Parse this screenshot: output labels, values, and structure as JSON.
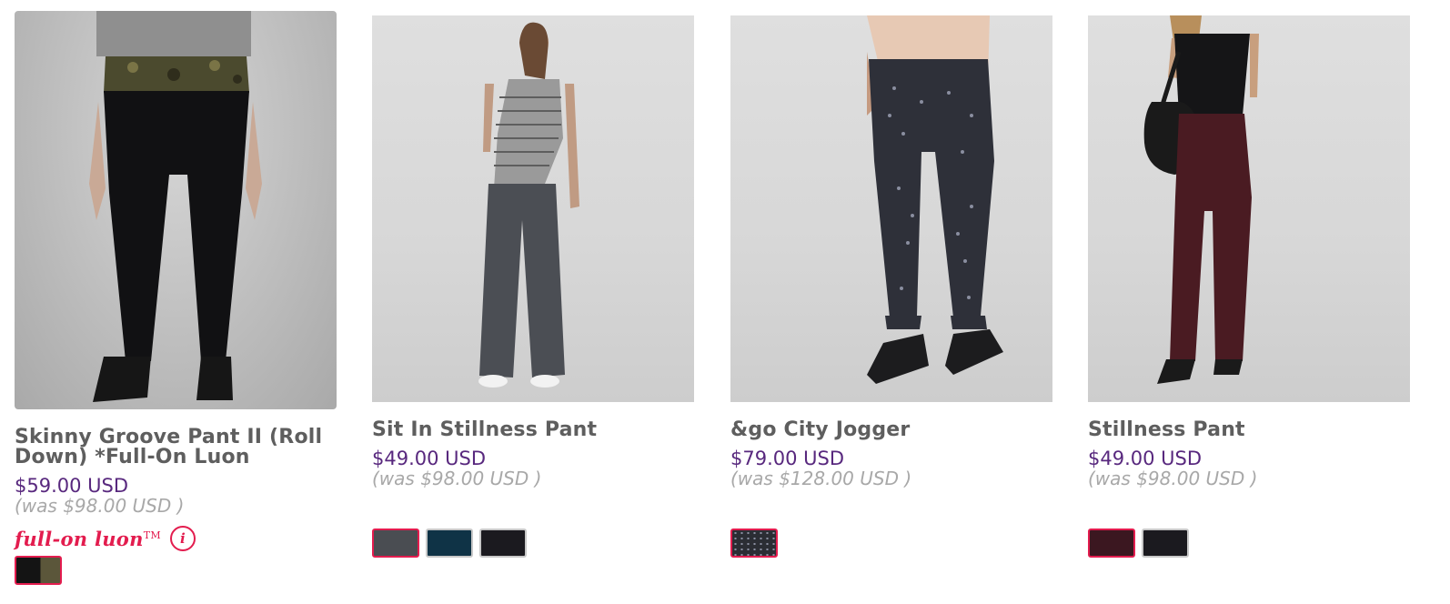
{
  "products": [
    {
      "name": "Skinny Groove Pant II (Roll Down) *Full-On Luon",
      "price": "$59.00 USD",
      "was": "(was $98.00 USD )",
      "tech_label": "full-on luon",
      "tech_mark": "TM",
      "info_glyph": "i",
      "swatches": [
        {
          "name": "black-camo",
          "color": "#161616",
          "selected": true
        }
      ]
    },
    {
      "name": "Sit In Stillness Pant",
      "price": "$49.00 USD",
      "was": "(was $98.00 USD )",
      "swatches": [
        {
          "name": "dark-grey",
          "color": "#4a4d52",
          "selected": true
        },
        {
          "name": "deep-teal",
          "color": "#0f3346",
          "selected": false
        },
        {
          "name": "black",
          "color": "#1b1a1f",
          "selected": false
        }
      ]
    },
    {
      "name": "&go City Jogger",
      "price": "$79.00 USD",
      "was": "(was $128.00 USD )",
      "swatches": [
        {
          "name": "speckled-black",
          "color": "#2b2d34",
          "selected": true
        }
      ]
    },
    {
      "name": "Stillness Pant",
      "price": "$49.00 USD",
      "was": "(was $98.00 USD )",
      "swatches": [
        {
          "name": "bordeaux",
          "color": "#3b1720",
          "selected": true
        },
        {
          "name": "black",
          "color": "#1b1a1f",
          "selected": false
        }
      ]
    }
  ],
  "colors": {
    "name": "#5e5e5e",
    "price": "#58287e",
    "was": "#a8a8a8",
    "accent": "#e31c4e"
  }
}
